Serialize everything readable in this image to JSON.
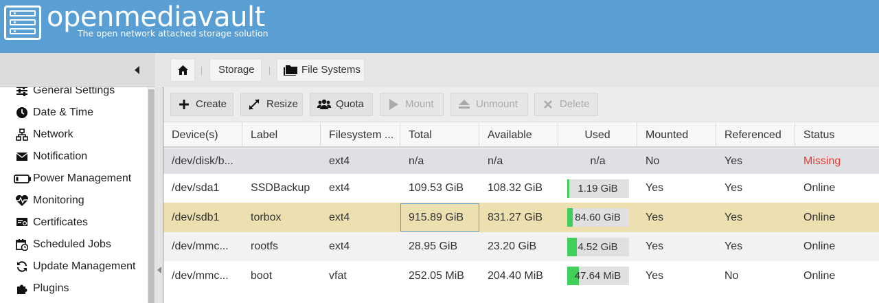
{
  "app": {
    "brand": "openmediavault",
    "tagline": "The open network attached storage solution"
  },
  "sidebar": {
    "items": [
      {
        "label": "General Settings",
        "icon": "sliders-icon"
      },
      {
        "label": "Date & Time",
        "icon": "clock-icon"
      },
      {
        "label": "Network",
        "icon": "network-icon"
      },
      {
        "label": "Notification",
        "icon": "envelope-icon"
      },
      {
        "label": "Power Management",
        "icon": "battery-icon"
      },
      {
        "label": "Monitoring",
        "icon": "heartbeat-icon"
      },
      {
        "label": "Certificates",
        "icon": "certificate-icon"
      },
      {
        "label": "Scheduled Jobs",
        "icon": "calendar-clock-icon"
      },
      {
        "label": "Update Management",
        "icon": "refresh-icon"
      },
      {
        "label": "Plugins",
        "icon": "puzzle-icon"
      }
    ]
  },
  "breadcrumb": {
    "storage": "Storage",
    "filesystems": "File Systems"
  },
  "toolbar": {
    "create": "Create",
    "resize": "Resize",
    "quota": "Quota",
    "mount": "Mount",
    "unmount": "Unmount",
    "delete": "Delete"
  },
  "grid": {
    "columns": [
      "Device(s)",
      "Label",
      "Filesystem ...",
      "Total",
      "Available",
      "Used",
      "Mounted",
      "Referenced",
      "Status"
    ],
    "rows": [
      {
        "device": "/dev/disk/b...",
        "label": "",
        "fs": "ext4",
        "total": "n/a",
        "available": "n/a",
        "used": "n/a",
        "used_fraction": null,
        "mounted": "No",
        "referenced": "Yes",
        "status": "Missing"
      },
      {
        "device": "/dev/sda1",
        "label": "SSDBackup",
        "fs": "ext4",
        "total": "109.53 GiB",
        "available": "108.32 GiB",
        "used": "1.19 GiB",
        "used_fraction": 0.011,
        "mounted": "Yes",
        "referenced": "Yes",
        "status": "Online"
      },
      {
        "device": "/dev/sdb1",
        "label": "torbox",
        "fs": "ext4",
        "total": "915.89 GiB",
        "available": "831.27 GiB",
        "used": "84.60 GiB",
        "used_fraction": 0.092,
        "mounted": "Yes",
        "referenced": "Yes",
        "status": "Online"
      },
      {
        "device": "/dev/mmc...",
        "label": "rootfs",
        "fs": "ext4",
        "total": "28.95 GiB",
        "available": "23.20 GiB",
        "used": "4.52 GiB",
        "used_fraction": 0.16,
        "mounted": "Yes",
        "referenced": "Yes",
        "status": "Online"
      },
      {
        "device": "/dev/mmc...",
        "label": "boot",
        "fs": "vfat",
        "total": "252.05 MiB",
        "available": "204.40 MiB",
        "used": "47.64 MiB",
        "used_fraction": 0.19,
        "mounted": "Yes",
        "referenced": "No",
        "status": "Online"
      }
    ]
  },
  "colors": {
    "header": "#5a9fd4",
    "used_bar": "#3fcf5a",
    "missing": "#e53935",
    "selected_row": "#ede0b0"
  }
}
